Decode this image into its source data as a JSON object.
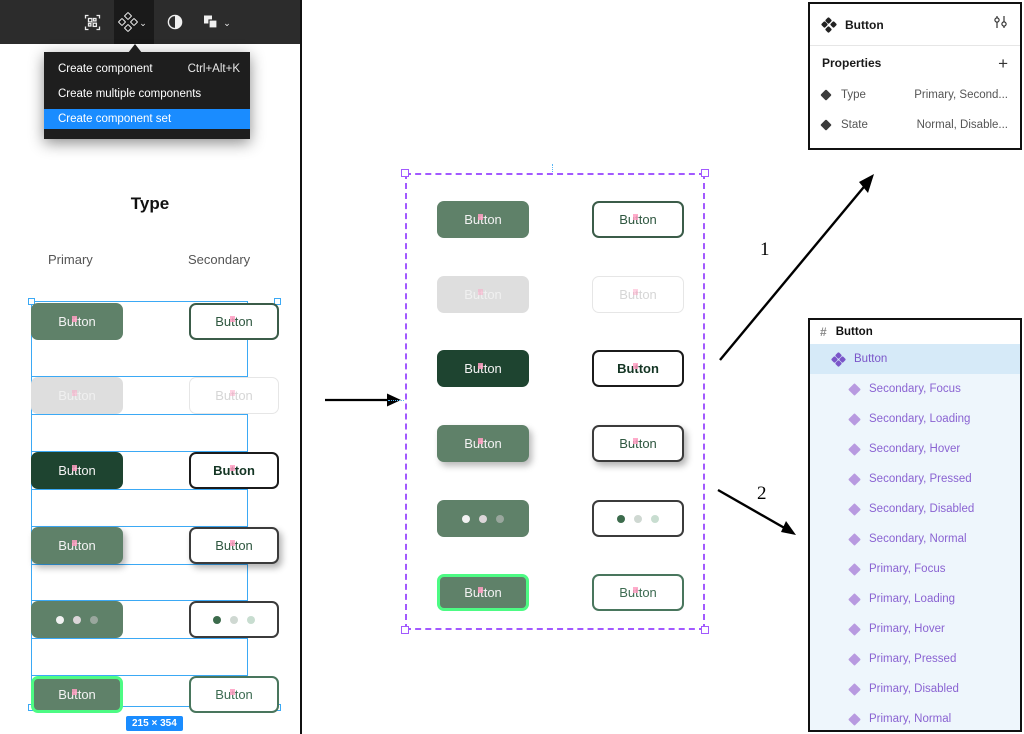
{
  "toolbar": {
    "tools": [
      {
        "name": "frame-region-icon",
        "label": "Frame region"
      },
      {
        "name": "create-component-icon",
        "label": "Create component"
      },
      {
        "name": "mask-icon",
        "label": "Use as mask"
      },
      {
        "name": "boolean-ops-icon",
        "label": "Boolean groups"
      }
    ],
    "chevron": "⌄"
  },
  "menu": {
    "items": [
      {
        "label": "Create component",
        "shortcut": "Ctrl+Alt+K",
        "selected": false
      },
      {
        "label": "Create multiple components",
        "shortcut": "",
        "selected": false
      },
      {
        "label": "Create component set",
        "shortcut": "",
        "selected": true
      }
    ]
  },
  "left_canvas": {
    "title": "Type",
    "column_labels": [
      "Primary",
      "Secondary"
    ],
    "size_badge": "215 × 354",
    "buttons": [
      {
        "label": "Button",
        "variant": "Primary, Normal"
      },
      {
        "label": "Button",
        "variant": "Secondary, Normal"
      },
      {
        "label": "Button",
        "variant": "Primary, Disabled"
      },
      {
        "label": "Button",
        "variant": "Secondary, Disabled"
      },
      {
        "label": "Button",
        "variant": "Primary, Pressed"
      },
      {
        "label": "Button",
        "variant": "Secondary, Pressed"
      },
      {
        "label": "Button",
        "variant": "Primary, Hover"
      },
      {
        "label": "Button",
        "variant": "Secondary, Hover"
      },
      {
        "label": "",
        "variant": "Primary, Loading"
      },
      {
        "label": "",
        "variant": "Secondary, Loading"
      },
      {
        "label": "Button",
        "variant": "Primary, Focus"
      },
      {
        "label": "Button",
        "variant": "Secondary, Focus"
      }
    ]
  },
  "center_canvas": {
    "buttons": [
      {
        "label": "Button",
        "variant": "Primary, Normal"
      },
      {
        "label": "Button",
        "variant": "Secondary, Normal"
      },
      {
        "label": "Button",
        "variant": "Primary, Disabled"
      },
      {
        "label": "Button",
        "variant": "Secondary, Disabled"
      },
      {
        "label": "Button",
        "variant": "Primary, Pressed"
      },
      {
        "label": "Button",
        "variant": "Secondary, Pressed"
      },
      {
        "label": "Button",
        "variant": "Primary, Hover"
      },
      {
        "label": "Button",
        "variant": "Secondary, Hover"
      },
      {
        "label": "",
        "variant": "Primary, Loading"
      },
      {
        "label": "",
        "variant": "Secondary, Loading"
      },
      {
        "label": "Button",
        "variant": "Primary, Focus"
      },
      {
        "label": "Button",
        "variant": "Secondary, Focus"
      }
    ]
  },
  "annotations": {
    "arrow_1": "1",
    "arrow_2": "2"
  },
  "properties_panel": {
    "header_title": "Button",
    "tune_icon": "tune-icon",
    "section_title": "Properties",
    "add_label": "+",
    "rows": [
      {
        "name": "Type",
        "value": "Primary, Second..."
      },
      {
        "name": "State",
        "value": "Normal, Disable..."
      }
    ]
  },
  "layers_panel": {
    "header_title": "Button",
    "component_name": "Button",
    "variants": [
      "Secondary, Focus",
      "Secondary, Loading",
      "Secondary, Hover",
      "Secondary, Pressed",
      "Secondary, Disabled",
      "Secondary, Normal",
      "Primary, Focus",
      "Primary, Loading",
      "Primary, Hover",
      "Primary, Pressed",
      "Primary, Disabled",
      "Primary, Normal"
    ]
  },
  "colors": {
    "primary_green": "#5f8169",
    "pressed_green": "#1e4430",
    "focus_ring": "#4dfb84",
    "component_purple": "#a259ff",
    "selection_blue": "#3ba9f5",
    "menu_highlight": "#1a8cff"
  }
}
